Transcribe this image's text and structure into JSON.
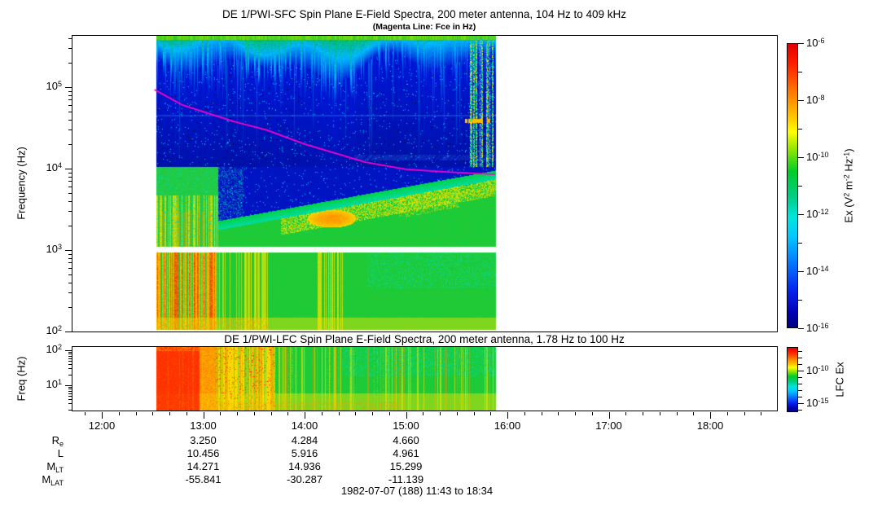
{
  "titles": {
    "sfc": "DE 1/PWI-SFC  Spin Plane E-Field Spectra, 200 meter antenna, 104 Hz to 409 kHz",
    "sfc_sub": "(Magenta Line: Fce in Hz)",
    "lfc": "DE 1/PWI-LFC  Spin Plane E-Field Spectra, 200 meter antenna, 1.78 Hz to 100 Hz",
    "caption": "1982-07-07 (188) 11:43 to 18:34"
  },
  "colors": {
    "background": "#ffffff",
    "frame": "#000000",
    "fce_line": "#ff00cc",
    "colormap_jet": [
      "#ff0000",
      "#ff8000",
      "#ffff00",
      "#00cc00",
      "#00ccff",
      "#0000ff",
      "#000080"
    ]
  },
  "axis": {
    "x_hour_labels": [
      "12:00",
      "13:00",
      "14:00",
      "15:00",
      "16:00",
      "17:00",
      "18:00"
    ],
    "x_hours": [
      12,
      13,
      14,
      15,
      16,
      17,
      18
    ],
    "x_minor_step_minutes": 10,
    "sfc_y_label": "Frequency (Hz)",
    "sfc_y_tick_labels": [
      "10^5",
      "10^4",
      "10^3",
      "10^2"
    ],
    "sfc_y_exps": [
      5,
      4,
      3,
      2
    ],
    "lfc_y_label": "Freq (Hz)",
    "lfc_y_tick_labels": [
      "10^2",
      "10^1"
    ],
    "lfc_y_exps": [
      2,
      1
    ]
  },
  "colorbars": {
    "sfc": {
      "label_segments": [
        {
          "t": "Ex (V"
        },
        {
          "sup": "2"
        },
        {
          "t": " m"
        },
        {
          "sup": "-2"
        },
        {
          "t": " Hz"
        },
        {
          "sup": "-1"
        },
        {
          "t": ")"
        }
      ],
      "tick_exps": [
        -6,
        -7,
        -8,
        -9,
        -10,
        -11,
        -12,
        -13,
        -14,
        -15,
        -16
      ],
      "labeled_exps": [
        -6,
        -8,
        -10,
        -12,
        -14,
        -16
      ],
      "labels": [
        "10^-6",
        "10^-8",
        "10^-10",
        "10^-12",
        "10^-14",
        "10^-16"
      ]
    },
    "lfc": {
      "label": "LFC Ex",
      "tick_exps": [
        -7,
        -8,
        -9,
        -10,
        -11,
        -12,
        -13,
        -14,
        -15,
        -16
      ],
      "labeled_exps": [
        -10,
        -15
      ],
      "labels": [
        "10^-10",
        "10^-15"
      ]
    }
  },
  "table": {
    "row_label_segments": [
      [
        {
          "t": "R"
        },
        {
          "sub": "e"
        }
      ],
      [
        {
          "t": "L"
        }
      ],
      [
        {
          "t": "M"
        },
        {
          "sub": "LT"
        }
      ],
      [
        {
          "t": "M"
        },
        {
          "sub": "LAT"
        }
      ]
    ],
    "column_hours": [
      13,
      14,
      15
    ],
    "values": [
      [
        "3.250",
        "4.284",
        "4.660"
      ],
      [
        "10.456",
        "5.916",
        "4.961"
      ],
      [
        "14.271",
        "14.936",
        "15.299"
      ],
      [
        "-55.841",
        "-30.287",
        "-11.139"
      ]
    ]
  },
  "chart_data": [
    {
      "type": "heatmap",
      "panel": "SFC spectrogram",
      "title": "DE 1/PWI-SFC  Spin Plane E-Field Spectra, 200 meter antenna, 104 Hz to 409 kHz",
      "subtitle": "(Magenta Line: Fce in Hz)",
      "xlabel": "",
      "ylabel": "Frequency (Hz)",
      "y_scale": "log",
      "y_range_hz": [
        104,
        430000
      ],
      "x_axis_time_range": [
        "11:42",
        "18:40"
      ],
      "x_tick_labels": [
        "12:00",
        "13:00",
        "14:00",
        "15:00",
        "16:00",
        "17:00",
        "18:00"
      ],
      "data_time_extent": [
        "12:31",
        "15:53"
      ],
      "colorbar_label": "Ex (V^2 m^-2 Hz^-1)",
      "colorbar_range": [
        "1e-6",
        "1e-16"
      ],
      "fce_line": {
        "color": "#ff00cc",
        "points_time_freq": [
          [
            12.52,
            93000
          ],
          [
            12.8,
            60000
          ],
          [
            13.0,
            50000
          ],
          [
            13.3,
            38000
          ],
          [
            13.62,
            30000
          ],
          [
            14.0,
            20000
          ],
          [
            14.6,
            12000
          ],
          [
            15.0,
            9800
          ],
          [
            15.4,
            9100
          ],
          [
            15.88,
            8500
          ]
        ]
      },
      "features": [
        "Green/yellow intensification along the top edge above ~200 kHz, fading after 14:30",
        "Deep blue background from ~10 kHz to 400 kHz with scattered cyan vertical striations",
        "Strong green/yellow vertical burst columns near 15:30-15:50 spanning 10-400 kHz",
        "Short orange horizontal streak near 35 kHz around 15:30-15:45",
        "Funnel of green/yellow/orange emission 1-10 kHz, most intense 12:30-13:30",
        "Dark blue wedge 3-10 kHz between ~13:10 and ~14:30",
        "Yellow band rising from ~2 kHz at 13:45 to ~5 kHz after 14:15, orange core near 14:20",
        "White instrument gap near 1 kHz across the whole pass",
        "Broadband green emission 104-900 Hz with orange/red streaks before 13:00 and yellow streaks near 13:50 and 14:30"
      ]
    },
    {
      "type": "heatmap",
      "panel": "LFC spectrogram",
      "title": "DE 1/PWI-LFC  Spin Plane E-Field Spectra, 200 meter antenna, 1.78 Hz to 100 Hz",
      "xlabel": "",
      "ylabel": "Freq (Hz)",
      "y_scale": "log",
      "y_range_hz": [
        1.78,
        100
      ],
      "x_axis_time_range": [
        "11:42",
        "18:40"
      ],
      "data_time_extent": [
        "12:31",
        "15:53"
      ],
      "colorbar_label": "LFC Ex",
      "colorbar_labeled_values": [
        "1e-10",
        "1e-15"
      ],
      "features": [
        "Saturated red broadband emission 12:30-12:55 at all frequencies",
        "Orange/yellow emission with embedded green columns until ~14:00",
        "Green background with cyan patches in upper rows after ~14:00",
        "Persistent yellow/orange band at the lowest frequencies for the whole pass"
      ]
    }
  ],
  "ephemeris_caption": "1982-07-07 (188) 11:43 to 18:34"
}
